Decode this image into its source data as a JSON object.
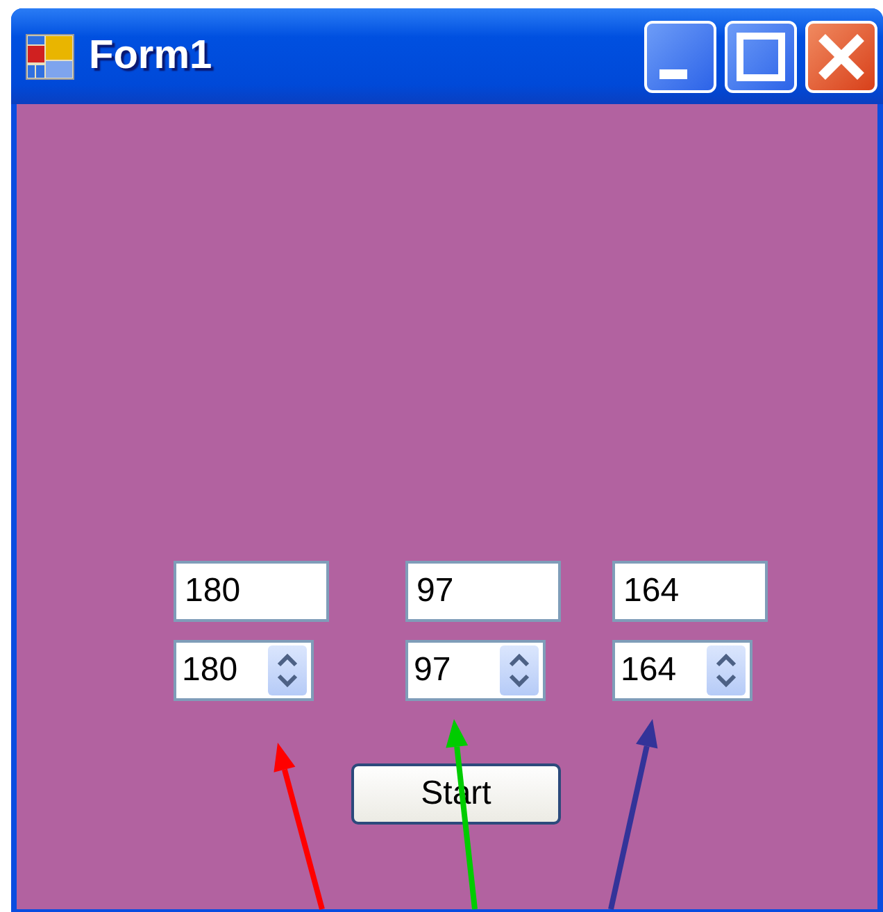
{
  "window": {
    "title": "Form1"
  },
  "text_boxes": [
    {
      "value": "180"
    },
    {
      "value": "97"
    },
    {
      "value": "164"
    }
  ],
  "spinners": [
    {
      "value": "180"
    },
    {
      "value": "97"
    },
    {
      "value": "164"
    }
  ],
  "button": "Start",
  "arrows": [
    {
      "color": "#ff0000"
    },
    {
      "color": "#00cc00"
    },
    {
      "color": "#333399"
    }
  ]
}
